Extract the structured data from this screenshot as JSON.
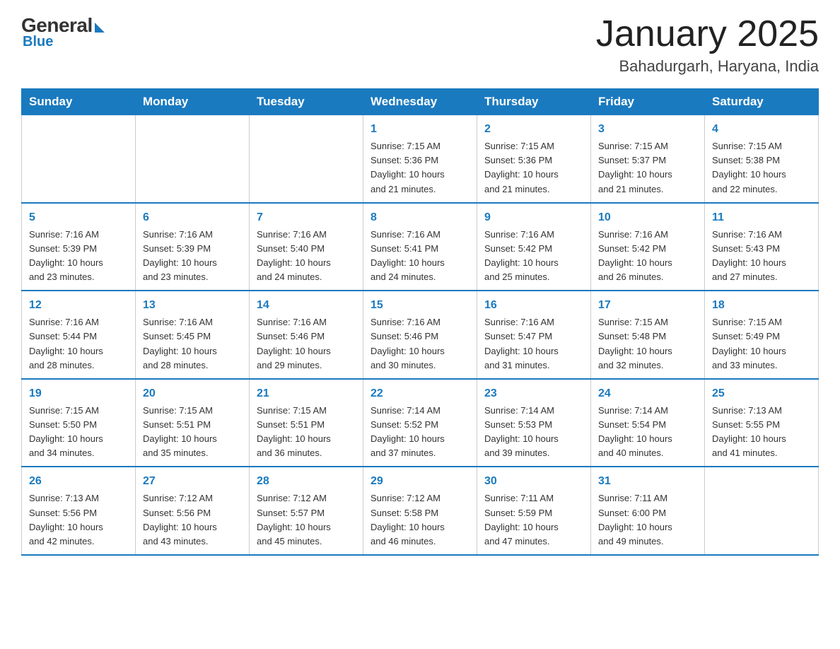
{
  "logo": {
    "general": "General",
    "blue": "Blue",
    "arrow": true
  },
  "header": {
    "title": "January 2025",
    "subtitle": "Bahadurgarh, Haryana, India"
  },
  "days_of_week": [
    "Sunday",
    "Monday",
    "Tuesday",
    "Wednesday",
    "Thursday",
    "Friday",
    "Saturday"
  ],
  "weeks": [
    [
      {
        "day": null,
        "info": null
      },
      {
        "day": null,
        "info": null
      },
      {
        "day": null,
        "info": null
      },
      {
        "day": "1",
        "info": "Sunrise: 7:15 AM\nSunset: 5:36 PM\nDaylight: 10 hours\nand 21 minutes."
      },
      {
        "day": "2",
        "info": "Sunrise: 7:15 AM\nSunset: 5:36 PM\nDaylight: 10 hours\nand 21 minutes."
      },
      {
        "day": "3",
        "info": "Sunrise: 7:15 AM\nSunset: 5:37 PM\nDaylight: 10 hours\nand 21 minutes."
      },
      {
        "day": "4",
        "info": "Sunrise: 7:15 AM\nSunset: 5:38 PM\nDaylight: 10 hours\nand 22 minutes."
      }
    ],
    [
      {
        "day": "5",
        "info": "Sunrise: 7:16 AM\nSunset: 5:39 PM\nDaylight: 10 hours\nand 23 minutes."
      },
      {
        "day": "6",
        "info": "Sunrise: 7:16 AM\nSunset: 5:39 PM\nDaylight: 10 hours\nand 23 minutes."
      },
      {
        "day": "7",
        "info": "Sunrise: 7:16 AM\nSunset: 5:40 PM\nDaylight: 10 hours\nand 24 minutes."
      },
      {
        "day": "8",
        "info": "Sunrise: 7:16 AM\nSunset: 5:41 PM\nDaylight: 10 hours\nand 24 minutes."
      },
      {
        "day": "9",
        "info": "Sunrise: 7:16 AM\nSunset: 5:42 PM\nDaylight: 10 hours\nand 25 minutes."
      },
      {
        "day": "10",
        "info": "Sunrise: 7:16 AM\nSunset: 5:42 PM\nDaylight: 10 hours\nand 26 minutes."
      },
      {
        "day": "11",
        "info": "Sunrise: 7:16 AM\nSunset: 5:43 PM\nDaylight: 10 hours\nand 27 minutes."
      }
    ],
    [
      {
        "day": "12",
        "info": "Sunrise: 7:16 AM\nSunset: 5:44 PM\nDaylight: 10 hours\nand 28 minutes."
      },
      {
        "day": "13",
        "info": "Sunrise: 7:16 AM\nSunset: 5:45 PM\nDaylight: 10 hours\nand 28 minutes."
      },
      {
        "day": "14",
        "info": "Sunrise: 7:16 AM\nSunset: 5:46 PM\nDaylight: 10 hours\nand 29 minutes."
      },
      {
        "day": "15",
        "info": "Sunrise: 7:16 AM\nSunset: 5:46 PM\nDaylight: 10 hours\nand 30 minutes."
      },
      {
        "day": "16",
        "info": "Sunrise: 7:16 AM\nSunset: 5:47 PM\nDaylight: 10 hours\nand 31 minutes."
      },
      {
        "day": "17",
        "info": "Sunrise: 7:15 AM\nSunset: 5:48 PM\nDaylight: 10 hours\nand 32 minutes."
      },
      {
        "day": "18",
        "info": "Sunrise: 7:15 AM\nSunset: 5:49 PM\nDaylight: 10 hours\nand 33 minutes."
      }
    ],
    [
      {
        "day": "19",
        "info": "Sunrise: 7:15 AM\nSunset: 5:50 PM\nDaylight: 10 hours\nand 34 minutes."
      },
      {
        "day": "20",
        "info": "Sunrise: 7:15 AM\nSunset: 5:51 PM\nDaylight: 10 hours\nand 35 minutes."
      },
      {
        "day": "21",
        "info": "Sunrise: 7:15 AM\nSunset: 5:51 PM\nDaylight: 10 hours\nand 36 minutes."
      },
      {
        "day": "22",
        "info": "Sunrise: 7:14 AM\nSunset: 5:52 PM\nDaylight: 10 hours\nand 37 minutes."
      },
      {
        "day": "23",
        "info": "Sunrise: 7:14 AM\nSunset: 5:53 PM\nDaylight: 10 hours\nand 39 minutes."
      },
      {
        "day": "24",
        "info": "Sunrise: 7:14 AM\nSunset: 5:54 PM\nDaylight: 10 hours\nand 40 minutes."
      },
      {
        "day": "25",
        "info": "Sunrise: 7:13 AM\nSunset: 5:55 PM\nDaylight: 10 hours\nand 41 minutes."
      }
    ],
    [
      {
        "day": "26",
        "info": "Sunrise: 7:13 AM\nSunset: 5:56 PM\nDaylight: 10 hours\nand 42 minutes."
      },
      {
        "day": "27",
        "info": "Sunrise: 7:12 AM\nSunset: 5:56 PM\nDaylight: 10 hours\nand 43 minutes."
      },
      {
        "day": "28",
        "info": "Sunrise: 7:12 AM\nSunset: 5:57 PM\nDaylight: 10 hours\nand 45 minutes."
      },
      {
        "day": "29",
        "info": "Sunrise: 7:12 AM\nSunset: 5:58 PM\nDaylight: 10 hours\nand 46 minutes."
      },
      {
        "day": "30",
        "info": "Sunrise: 7:11 AM\nSunset: 5:59 PM\nDaylight: 10 hours\nand 47 minutes."
      },
      {
        "day": "31",
        "info": "Sunrise: 7:11 AM\nSunset: 6:00 PM\nDaylight: 10 hours\nand 49 minutes."
      },
      {
        "day": null,
        "info": null
      }
    ]
  ]
}
